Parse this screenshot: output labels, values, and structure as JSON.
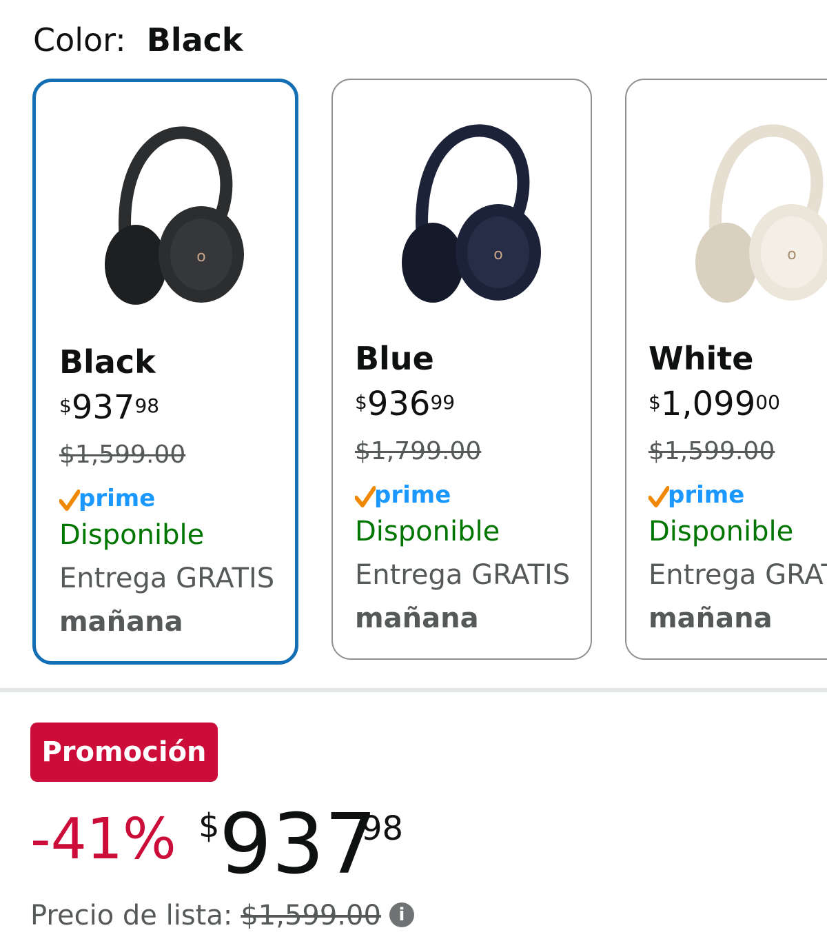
{
  "color_selector": {
    "label": "Color:",
    "selected": "Black"
  },
  "swatches": [
    {
      "name": "Black",
      "price_symbol": "$",
      "price_whole": "937",
      "price_cents": "98",
      "list_price": "$1,599.00",
      "prime": "prime",
      "availability": "Disponible",
      "shipping": "Entrega GRATIS",
      "delivery_day": "mañana",
      "headphone_color": "#2b2d2f",
      "selected": true
    },
    {
      "name": "Blue",
      "price_symbol": "$",
      "price_whole": "936",
      "price_cents": "99",
      "list_price": "$1,799.00",
      "prime": "prime",
      "availability": "Disponible",
      "shipping": "Entrega GRATIS",
      "delivery_day": "mañana",
      "headphone_color": "#1c2238",
      "selected": false
    },
    {
      "name": "White",
      "price_symbol": "$",
      "price_whole": "1,099",
      "price_cents": "00",
      "list_price": "$1,599.00",
      "prime": "prime",
      "availability": "Disponible",
      "shipping": "Entrega GRATIS",
      "delivery_day": "mañana",
      "headphone_color": "#ece6da",
      "selected": false
    }
  ],
  "promo_badge": "Promoción",
  "deal": {
    "discount": "-41%",
    "price_symbol": "$",
    "price_whole": "937",
    "price_cents": "98"
  },
  "list_price": {
    "label": "Precio de lista:",
    "amount": "$1,599.00",
    "info_icon": "info-icon",
    "info_glyph": "i"
  },
  "colors": {
    "selected_border": "#146eb4",
    "prime_blue": "#1a98ff",
    "prime_check": "#f08804",
    "available_green": "#007600",
    "promo_red": "#cc0c39"
  }
}
